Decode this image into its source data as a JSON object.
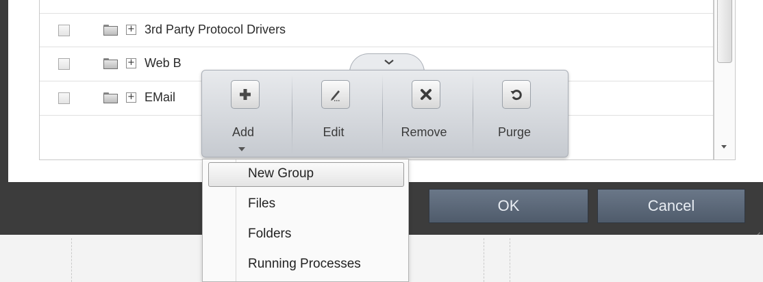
{
  "group_list": {
    "rows": [
      {
        "label": "3rd Party Protocol Drivers"
      },
      {
        "label": "Web B"
      },
      {
        "label": "EMail"
      }
    ]
  },
  "toolbar": {
    "tools": [
      {
        "label": "Add",
        "icon": "plus-icon"
      },
      {
        "label": "Edit",
        "icon": "pencil-icon"
      },
      {
        "label": "Remove",
        "icon": "x-icon"
      },
      {
        "label": "Purge",
        "icon": "refresh-icon"
      }
    ]
  },
  "add_menu": {
    "items": [
      {
        "label": "New Group"
      },
      {
        "label": "Files"
      },
      {
        "label": "Folders"
      },
      {
        "label": "Running Processes"
      }
    ]
  },
  "dialog_buttons": {
    "ok_label": "OK",
    "cancel_label": "Cancel"
  }
}
